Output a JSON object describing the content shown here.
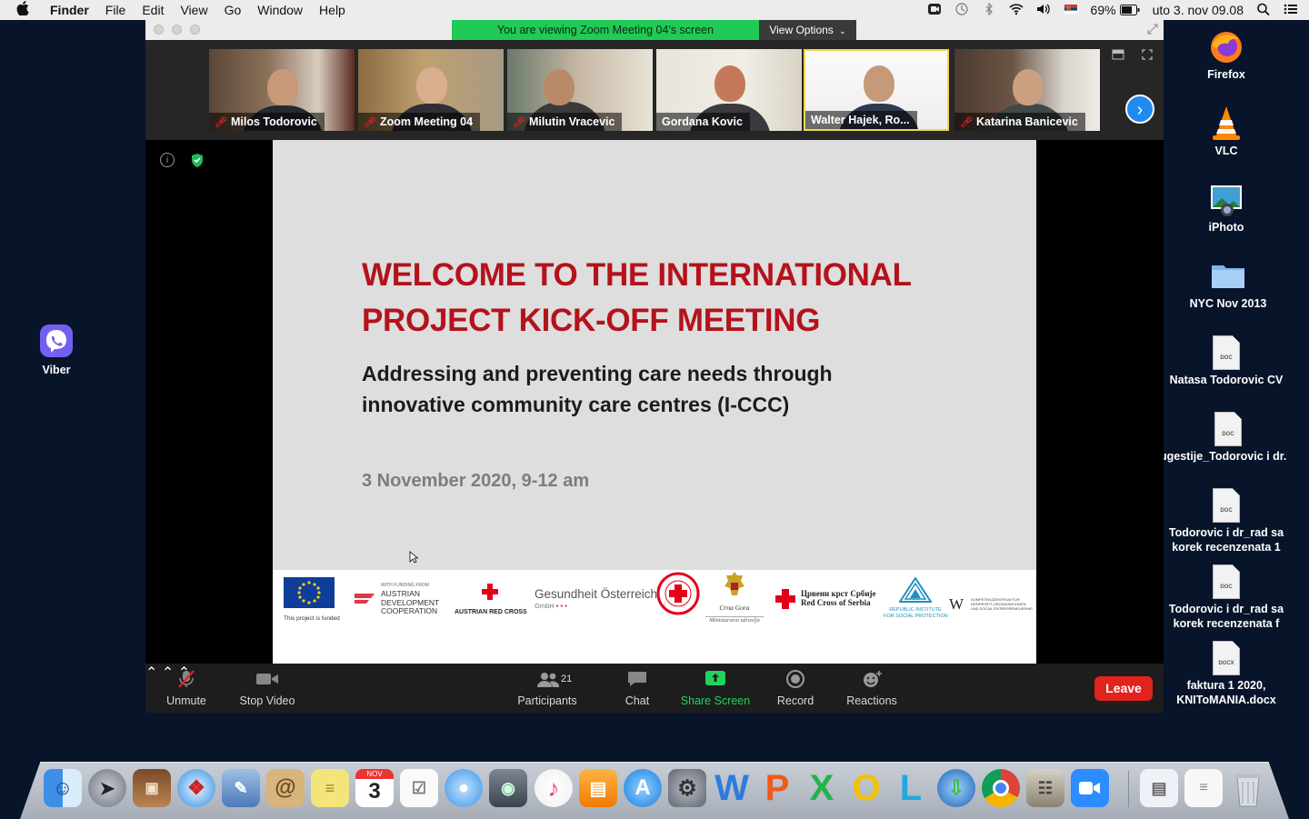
{
  "menubar": {
    "app_name": "Finder",
    "items": [
      "File",
      "Edit",
      "View",
      "Go",
      "Window",
      "Help"
    ],
    "battery": "69%",
    "datetime": "uto 3. nov  09.08"
  },
  "zoom": {
    "viewing_banner": "You are viewing Zoom Meeting 04's screen",
    "view_options": "View Options",
    "participants": [
      {
        "name": "Milos Todorovic",
        "muted": true
      },
      {
        "name": "Zoom Meeting 04",
        "muted": true
      },
      {
        "name": "Milutin Vracevic",
        "muted": true
      },
      {
        "name": "Gordana Kovic",
        "muted": false
      },
      {
        "name": "Walter Hajek, Ro...",
        "muted": false,
        "active": true
      },
      {
        "name": "Katarina Banicevic",
        "muted": true
      }
    ],
    "slide": {
      "title_line1": "WELCOME TO THE INTERNATIONAL",
      "title_line2": "PROJECT KICK-OFF MEETING",
      "subtitle_line1": "Addressing and preventing care needs through",
      "subtitle_line2": "innovative community care centres (I-CCC)",
      "date": "3 November 2020, 9-12 am",
      "logos": {
        "eu_caption": "This project is funded",
        "ada_small": "WITH FUNDING FROM",
        "ada_line1": "AUSTRIAN",
        "ada_line2": "DEVELOPMENT",
        "ada_line3": "COOPERATION",
        "arc": "AUSTRIAN RED CROSS",
        "goeg_line1": "Gesundheit Österreich",
        "goeg_line2": "GmbH",
        "mne_line1": "Crna Gora",
        "mne_line2": "Ministarstvo zdravlja",
        "serbia_line1": "Црвени крст Србије",
        "serbia_line2": "Red Cross of Serbia",
        "rsp_line1": "REPUBLIC INSTITUTE",
        "rsp_line2": "FOR SOCIAL PROTECTION",
        "wu_mark": "W",
        "wu_line1": "KOMPETENZZENTRUM FÜR",
        "wu_line2": "NONPROFIT-ORGANISATIONEN",
        "wu_line3": "UND SOCIAL ENTREPRENEURSHIP"
      }
    },
    "toolbar": {
      "unmute": "Unmute",
      "stop_video": "Stop Video",
      "participants": "Participants",
      "participants_count": "21",
      "chat": "Chat",
      "share_screen": "Share Screen",
      "record": "Record",
      "reactions": "Reactions",
      "leave": "Leave"
    }
  },
  "desktop": {
    "left_icons": [
      {
        "label": "Viber",
        "icon": "viber-icon"
      }
    ],
    "right_icons": [
      {
        "label": "Firefox",
        "icon": "firefox-icon"
      },
      {
        "label": "VLC",
        "icon": "vlc-icon"
      },
      {
        "label": "iPhoto",
        "icon": "iphoto-icon"
      },
      {
        "label": "NYC Nov 2013",
        "icon": "folder-icon"
      },
      {
        "label": "Natasa Todorovic CV",
        "icon": "doc-icon",
        "badge": "DOC"
      },
      {
        "label": "ugestije_Todorovic i dr.",
        "icon": "doc-icon",
        "badge": "DOC"
      },
      {
        "label": "Todorovic i dr_rad sa korek recenzenata 1",
        "icon": "doc-icon",
        "badge": "DOC"
      },
      {
        "label": "Todorovic i dr_rad sa korek recenzenata f",
        "icon": "doc-icon",
        "badge": "DOC"
      },
      {
        "label": "faktura 1 2020, KNIToMANIA.docx",
        "icon": "doc-icon",
        "badge": "DOCX"
      }
    ]
  },
  "dock": {
    "calendar_month": "NOV",
    "calendar_day": "3",
    "apps": [
      "finder",
      "launchpad",
      "photo-booth",
      "safari",
      "preview",
      "contacts",
      "stickies",
      "calendar",
      "reminders",
      "messages",
      "facetime",
      "itunes",
      "ibooks",
      "app-store",
      "system-preferences",
      "word",
      "powerpoint",
      "excel",
      "outlook",
      "lync",
      "downloads",
      "chrome",
      "photos",
      "zoom",
      "documents",
      "trash"
    ]
  },
  "colors": {
    "zoom_green": "#21c957",
    "slide_title_red": "#b4121c",
    "leave_red": "#e0231d",
    "share_green": "#23d160",
    "desktop_bg": "#08142a"
  }
}
